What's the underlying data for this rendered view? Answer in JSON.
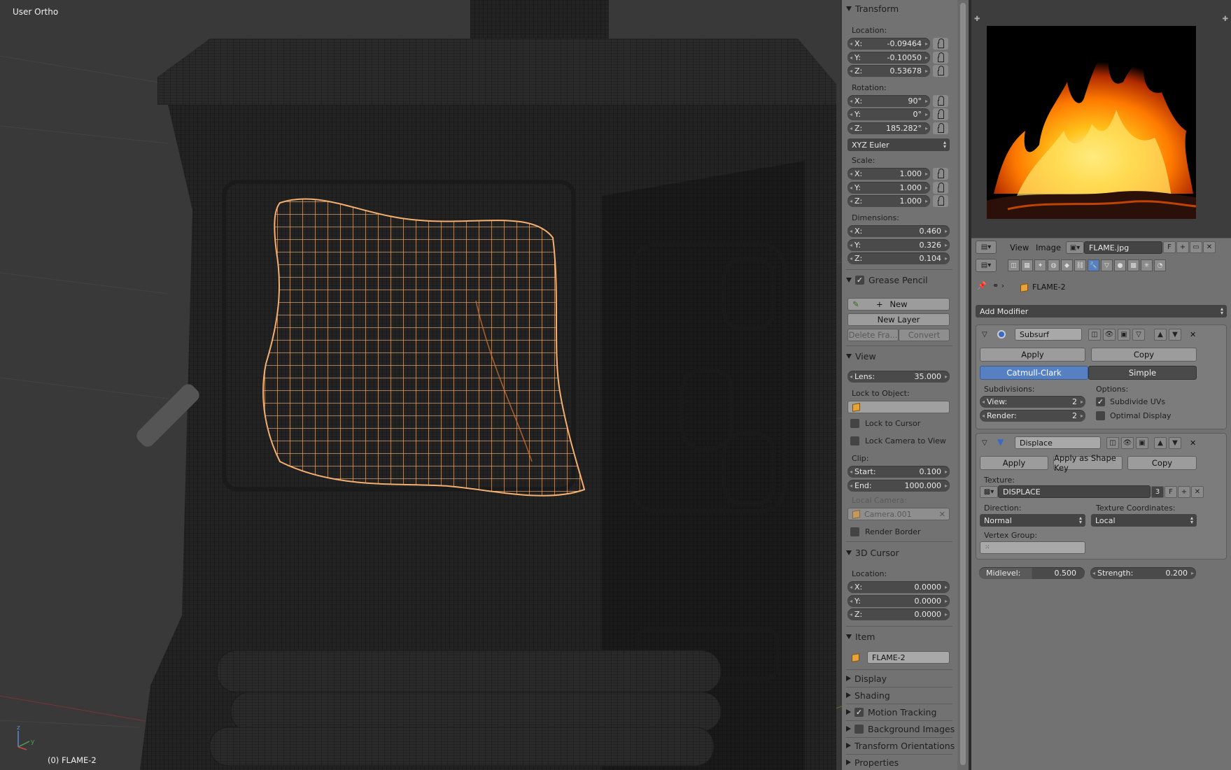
{
  "viewport": {
    "view_name": "User Ortho",
    "object_label": "(0) FLAME-2",
    "axis_x": "x",
    "axis_y": "y",
    "axis_z": "z"
  },
  "transform": {
    "title": "Transform",
    "location_label": "Location:",
    "location": [
      {
        "k": "X:",
        "v": "-0.09464"
      },
      {
        "k": "Y:",
        "v": "-0.10050"
      },
      {
        "k": "Z:",
        "v": "0.53678"
      }
    ],
    "rotation_label": "Rotation:",
    "rotation": [
      {
        "k": "X:",
        "v": "90°"
      },
      {
        "k": "Y:",
        "v": "0°"
      },
      {
        "k": "Z:",
        "v": "185.282°"
      }
    ],
    "rotation_mode": "XYZ Euler",
    "scale_label": "Scale:",
    "scale": [
      {
        "k": "X:",
        "v": "1.000"
      },
      {
        "k": "Y:",
        "v": "1.000"
      },
      {
        "k": "Z:",
        "v": "1.000"
      }
    ],
    "dimensions_label": "Dimensions:",
    "dimensions": [
      {
        "k": "X:",
        "v": "0.460"
      },
      {
        "k": "Y:",
        "v": "0.326"
      },
      {
        "k": "Z:",
        "v": "0.104"
      }
    ]
  },
  "grease_pencil": {
    "title": "Grease Pencil",
    "new_label": "New",
    "new_layer_label": "New Layer",
    "delete_label": "Delete Fra...",
    "convert_label": "Convert"
  },
  "view": {
    "title": "View",
    "lens_label": "Lens:",
    "lens_value": "35.000",
    "lock_object_label": "Lock to Object:",
    "lock_cursor_label": "Lock to Cursor",
    "lock_camera_label": "Lock Camera to View",
    "clip_label": "Clip:",
    "clip_start_label": "Start:",
    "clip_start": "0.100",
    "clip_end_label": "End:",
    "clip_end": "1000.000",
    "local_camera_label": "Local Camera:",
    "local_camera": "Camera.001",
    "render_border_label": "Render Border"
  },
  "cursor": {
    "title": "3D Cursor",
    "location_label": "Location:",
    "location": [
      {
        "k": "X:",
        "v": "0.0000"
      },
      {
        "k": "Y:",
        "v": "0.0000"
      },
      {
        "k": "Z:",
        "v": "0.0000"
      }
    ]
  },
  "item": {
    "title": "Item",
    "name": "FLAME-2"
  },
  "collapsed_panels": [
    {
      "label": "Display",
      "check": false
    },
    {
      "label": "Shading",
      "check": false
    },
    {
      "label": "Motion Tracking",
      "check": true
    },
    {
      "label": "Background Images",
      "check": "off"
    },
    {
      "label": "Transform Orientations",
      "check": false
    },
    {
      "label": "Properties",
      "check": false
    }
  ],
  "image_editor": {
    "view_menu": "View",
    "image_menu": "Image",
    "image_name": "FLAME.jpg",
    "fake_user": "F"
  },
  "properties": {
    "object_name": "FLAME-2",
    "add_modifier": "Add Modifier",
    "subsurf": {
      "name": "Subsurf",
      "apply": "Apply",
      "copy": "Copy",
      "mode_a": "Catmull-Clark",
      "mode_b": "Simple",
      "subdivisions_label": "Subdivisions:",
      "view_label": "View:",
      "view_value": "2",
      "render_label": "Render:",
      "render_value": "2",
      "options_label": "Options:",
      "subdivide_uvs": "Subdivide UVs",
      "optimal_display": "Optimal Display"
    },
    "displace": {
      "name": "Displace",
      "apply": "Apply",
      "apply_shape": "Apply as Shape Key",
      "copy": "Copy",
      "texture_label": "Texture:",
      "texture_name": "DISPLACE",
      "texture_users": "3",
      "texture_fake": "F",
      "direction_label": "Direction:",
      "direction": "Normal",
      "coords_label": "Texture Coordinates:",
      "coords": "Local",
      "vgroup_label": "Vertex Group:",
      "midlevel_label": "Midlevel:",
      "midlevel": "0.500",
      "strength_label": "Strength:",
      "strength": "0.200"
    }
  },
  "colors": {
    "accent": "#5680c2",
    "selected_wire": "#f0a860",
    "panel_bg": "#727272",
    "viewport_bg": "#393939"
  }
}
